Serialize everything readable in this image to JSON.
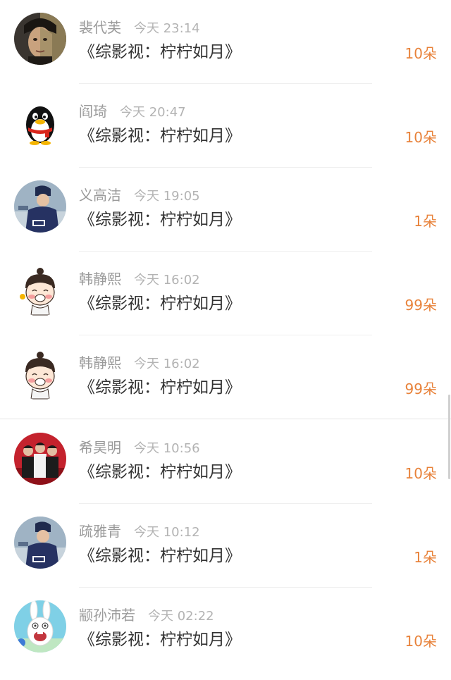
{
  "rows": [
    {
      "name": "裴代芙",
      "time": "今天 23:14",
      "title": "《综影视：柠柠如月》",
      "gift": "10朵",
      "avatar": "portrait-avatar"
    },
    {
      "name": "阎琦",
      "time": "今天 20:47",
      "title": "《综影视：柠柠如月》",
      "gift": "10朵",
      "avatar": "qq-penguin-avatar"
    },
    {
      "name": "义高洁",
      "time": "今天 19:05",
      "title": "《综影视：柠柠如月》",
      "gift": "1朵",
      "avatar": "player-avatar"
    },
    {
      "name": "韩静熙",
      "time": "今天 16:02",
      "title": "《综影视：柠柠如月》",
      "gift": "99朵",
      "avatar": "cartoon-girl-avatar"
    },
    {
      "name": "韩静熙",
      "time": "今天 16:02",
      "title": "《综影视：柠柠如月》",
      "gift": "99朵",
      "avatar": "cartoon-girl-avatar"
    },
    {
      "name": "希昊明",
      "time": "今天 10:56",
      "title": "《综影视：柠柠如月》",
      "gift": "10朵",
      "avatar": "group-photo-avatar"
    },
    {
      "name": "疏雅青",
      "time": "今天 10:12",
      "title": "《综影视：柠柠如月》",
      "gift": "1朵",
      "avatar": "player-avatar"
    },
    {
      "name": "颛孙沛若",
      "time": "今天 02:22",
      "title": "《综影视：柠柠如月》",
      "gift": "10朵",
      "avatar": "rabbid-avatar"
    }
  ],
  "colors": {
    "gift": "#e8823a",
    "name": "#9a9a9a",
    "title": "#333333"
  }
}
